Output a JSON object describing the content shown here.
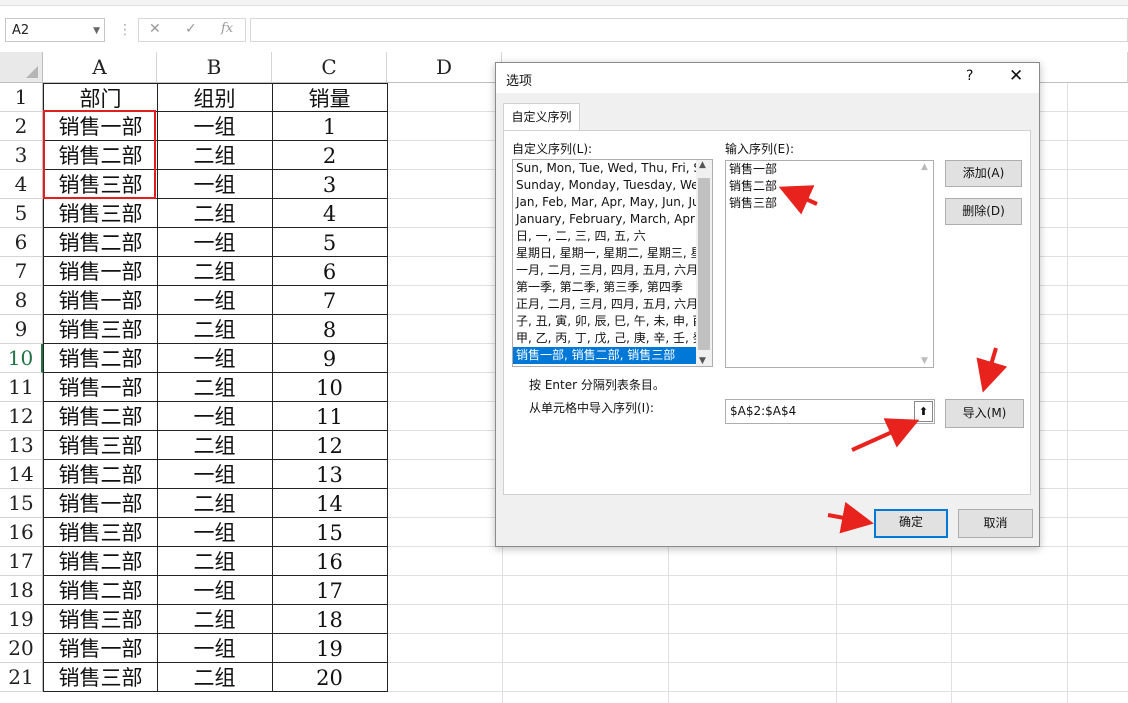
{
  "formula_bar": {
    "name_box": "A2",
    "cancel_icon": "✕",
    "confirm_icon": "✓",
    "fx_label": "fx",
    "formula": ""
  },
  "columns": [
    "A",
    "B",
    "C",
    "D"
  ],
  "rows": [
    {
      "n": "1",
      "a": "部门",
      "b": "组别",
      "c": "销量"
    },
    {
      "n": "2",
      "a": "销售一部",
      "b": "一组",
      "c": "1"
    },
    {
      "n": "3",
      "a": "销售二部",
      "b": "二组",
      "c": "2"
    },
    {
      "n": "4",
      "a": "销售三部",
      "b": "一组",
      "c": "3"
    },
    {
      "n": "5",
      "a": "销售三部",
      "b": "二组",
      "c": "4"
    },
    {
      "n": "6",
      "a": "销售二部",
      "b": "一组",
      "c": "5"
    },
    {
      "n": "7",
      "a": "销售一部",
      "b": "二组",
      "c": "6"
    },
    {
      "n": "8",
      "a": "销售一部",
      "b": "一组",
      "c": "7"
    },
    {
      "n": "9",
      "a": "销售三部",
      "b": "二组",
      "c": "8"
    },
    {
      "n": "10",
      "a": "销售二部",
      "b": "一组",
      "c": "9"
    },
    {
      "n": "11",
      "a": "销售一部",
      "b": "二组",
      "c": "10"
    },
    {
      "n": "12",
      "a": "销售二部",
      "b": "一组",
      "c": "11"
    },
    {
      "n": "13",
      "a": "销售三部",
      "b": "二组",
      "c": "12"
    },
    {
      "n": "14",
      "a": "销售二部",
      "b": "一组",
      "c": "13"
    },
    {
      "n": "15",
      "a": "销售一部",
      "b": "二组",
      "c": "14"
    },
    {
      "n": "16",
      "a": "销售三部",
      "b": "一组",
      "c": "15"
    },
    {
      "n": "17",
      "a": "销售二部",
      "b": "二组",
      "c": "16"
    },
    {
      "n": "18",
      "a": "销售二部",
      "b": "一组",
      "c": "17"
    },
    {
      "n": "19",
      "a": "销售三部",
      "b": "二组",
      "c": "18"
    },
    {
      "n": "20",
      "a": "销售一部",
      "b": "一组",
      "c": "19"
    },
    {
      "n": "21",
      "a": "销售三部",
      "b": "二组",
      "c": "20"
    }
  ],
  "active_row": "10",
  "dialog": {
    "title": "选项",
    "help": "?",
    "close": "✕",
    "tab": "自定义序列",
    "lists_label": "自定义序列(L):",
    "lists": [
      "Sun, Mon, Tue, Wed, Thu, Fri, S",
      "Sunday, Monday, Tuesday, Wed",
      "Jan, Feb, Mar, Apr, May, Jun, Ju",
      "January, February, March, April,",
      "日, 一, 二, 三, 四, 五, 六",
      "星期日, 星期一, 星期二, 星期三, 星",
      "一月, 二月, 三月, 四月, 五月, 六月,",
      "第一季, 第二季, 第三季, 第四季",
      "正月, 二月, 三月, 四月, 五月, 六月,",
      "子, 丑, 寅, 卯, 辰, 巳, 午, 未, 申, 酉",
      "甲, 乙, 丙, 丁, 戊, 己, 庚, 辛, 壬, 癸",
      "销售一部, 销售二部, 销售三部"
    ],
    "selected_index": 11,
    "entries_label": "输入序列(E):",
    "entries": [
      "销售一部",
      "销售二部",
      "销售三部"
    ],
    "add_button": "添加(A)",
    "delete_button": "删除(D)",
    "hint": "按 Enter 分隔列表条目。",
    "import_label": "从单元格中导入序列(I):",
    "import_ref": "$A$2:$A$4",
    "import_button": "导入(M)",
    "ok_button": "确定",
    "cancel_button": "取消"
  },
  "colors": {
    "highlight_red": "#e02020",
    "arrow_red": "#e8231e",
    "selection_blue": "#0078d7",
    "active_green": "#217346"
  }
}
